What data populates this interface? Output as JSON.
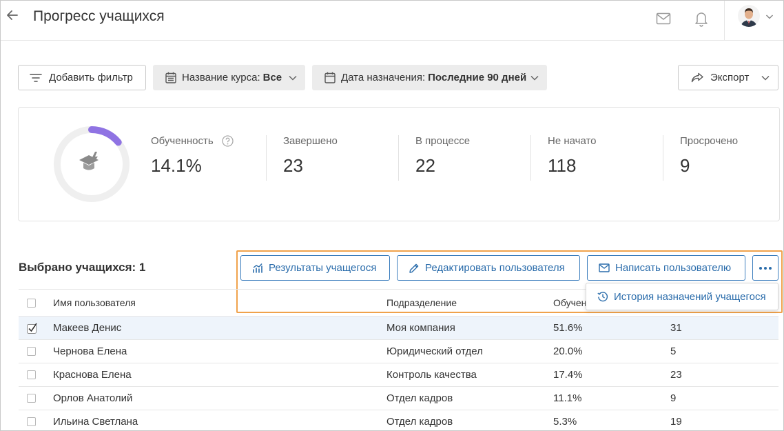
{
  "header": {
    "title": "Прогресс учащихся"
  },
  "filters": {
    "add_filter": "Добавить фильтр",
    "course_label": "Название курса:",
    "course_value": "Все",
    "date_label": "Дата назначения:",
    "date_value": "Последние 90 дней",
    "export": "Экспорт"
  },
  "stats": {
    "progress_fraction": 0.141,
    "items": [
      {
        "label": "Обученность",
        "value": "14.1%"
      },
      {
        "label": "Завершено",
        "value": "23"
      },
      {
        "label": "В процессе",
        "value": "22"
      },
      {
        "label": "Не начато",
        "value": "118"
      },
      {
        "label": "Просрочено",
        "value": "9"
      }
    ]
  },
  "selection": {
    "count_text": "Выбрано учащихся: 1",
    "actions": {
      "results": "Результаты учащегося",
      "edit": "Редактировать пользователя",
      "message": "Написать пользователю",
      "history": "История назначений учащегося"
    }
  },
  "table": {
    "columns": {
      "name": "Имя пользователя",
      "dept": "Подразделение",
      "progress": "Обучен"
    },
    "rows": [
      {
        "name": "Макеев Денис",
        "dept": "Моя компания",
        "progress": "51.6%",
        "num": "31",
        "checked": true
      },
      {
        "name": "Чернова Елена",
        "dept": "Юридический отдел",
        "progress": "20.0%",
        "num": "5",
        "checked": false
      },
      {
        "name": "Краснова Елена",
        "dept": "Контроль качества",
        "progress": "17.4%",
        "num": "23",
        "checked": false
      },
      {
        "name": "Орлов Анатолий",
        "dept": "Отдел кадров",
        "progress": "11.1%",
        "num": "9",
        "checked": false
      },
      {
        "name": "Ильина Светлана",
        "dept": "Отдел кадров",
        "progress": "5.3%",
        "num": "19",
        "checked": false
      }
    ]
  },
  "colors": {
    "accent": "#2a6cab",
    "highlight": "#f0a24b",
    "progress_arc": "#8f73e3",
    "selected_row": "#eef4fb"
  },
  "icons": [
    "back-arrow-icon",
    "mail-icon",
    "bell-icon",
    "chevron-down-icon",
    "filter-lines-icon",
    "calendar-icon",
    "share-arrow-icon",
    "graduation-cap-icon",
    "help-circle-icon",
    "chart-icon",
    "pencil-icon",
    "envelope-icon",
    "more-dots-icon",
    "history-icon",
    "check-icon"
  ]
}
